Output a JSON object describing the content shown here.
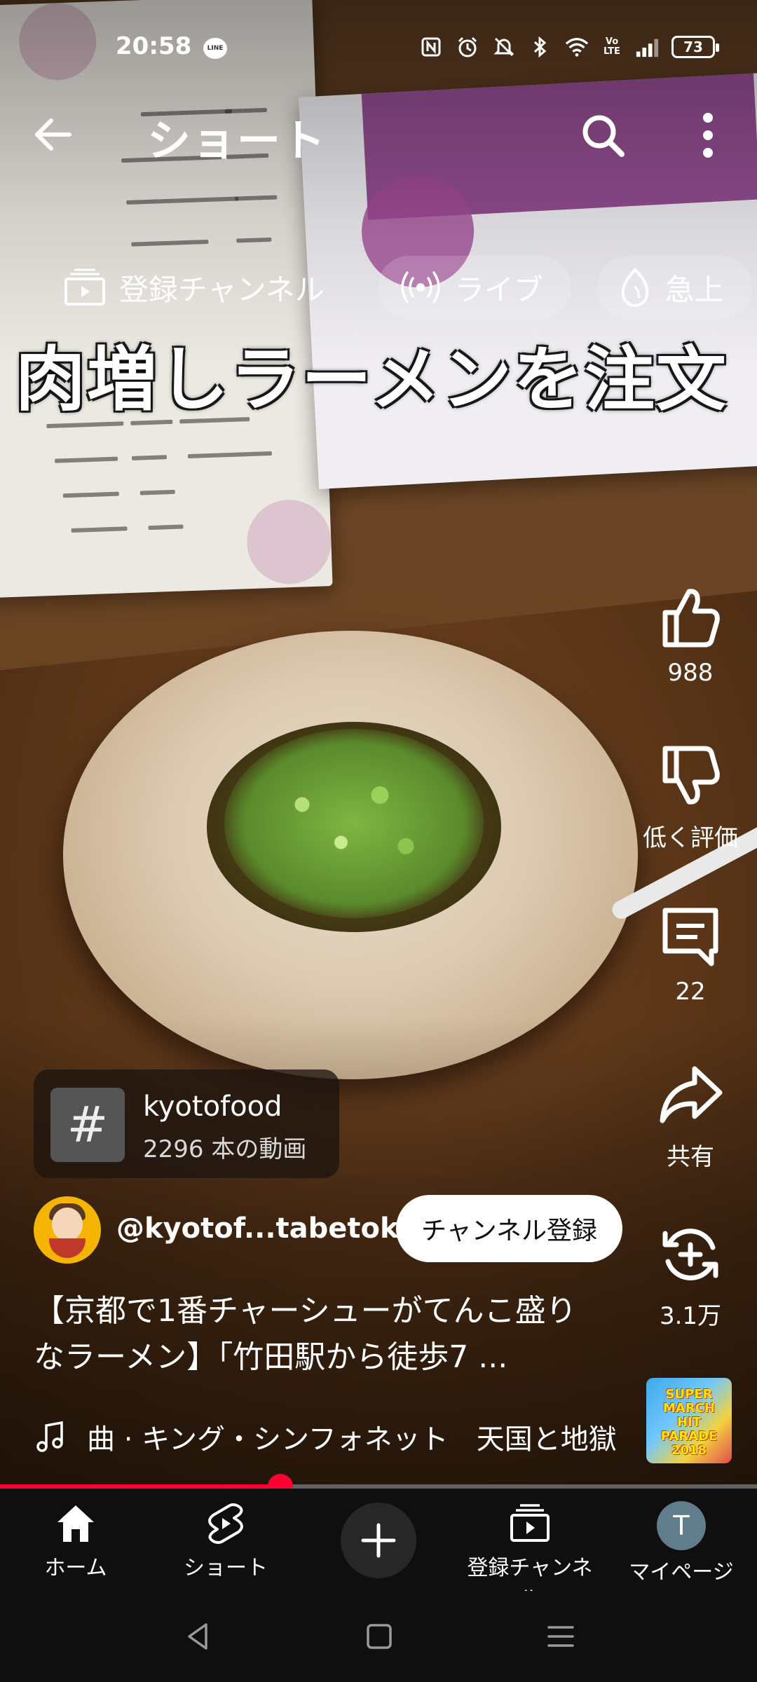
{
  "status_bar": {
    "time": "20:58",
    "notification_app": "LINE",
    "icons": [
      "nfc-icon",
      "alarm-icon",
      "mute-icon",
      "bluetooth-icon",
      "wifi-icon",
      "volte-icon",
      "signal-icon"
    ],
    "volte_label": "Vo LTE",
    "battery": "73"
  },
  "header": {
    "title": "ショート"
  },
  "chips": [
    {
      "label": "登録チャンネル",
      "icon": "subscriptions-icon"
    },
    {
      "label": "ライブ",
      "icon": "live-icon"
    },
    {
      "label": "急上",
      "icon": "trending-icon"
    }
  ],
  "video": {
    "caption": "肉増しラーメンを注文",
    "progress": 0.37
  },
  "actions": {
    "like_count": "988",
    "dislike_label": "低く評価",
    "comment_count": "22",
    "share_label": "共有",
    "remix_count": "3.1万"
  },
  "hashtag": {
    "symbol": "#",
    "name": "kyotofood",
    "count": "2296 本の動画"
  },
  "channel": {
    "handle": "@kyotof...tabetoku",
    "subscribe_label": "チャンネル登録"
  },
  "description": "【京都で1番チャーシューがてんこ盛りなラーメン】「竹田駅から徒歩7 ...",
  "music": {
    "text": "曲 · キング・シンフォネット　天国と地獄",
    "thumb_text": "SUPER MARCH HIT PARADE 2018"
  },
  "bottom_nav": [
    {
      "label": "ホーム",
      "icon": "home-icon"
    },
    {
      "label": "ショート",
      "icon": "shorts-icon"
    },
    {
      "label": "",
      "icon": "create-icon"
    },
    {
      "label": "登録チャンネル",
      "icon": "subscriptions-icon"
    },
    {
      "label": "マイページ",
      "icon": "avatar"
    }
  ],
  "profile_initial": "T",
  "colors": {
    "accent": "#ff0033",
    "background": "#0f0f0f",
    "subscribe_bg": "#ffffff"
  }
}
